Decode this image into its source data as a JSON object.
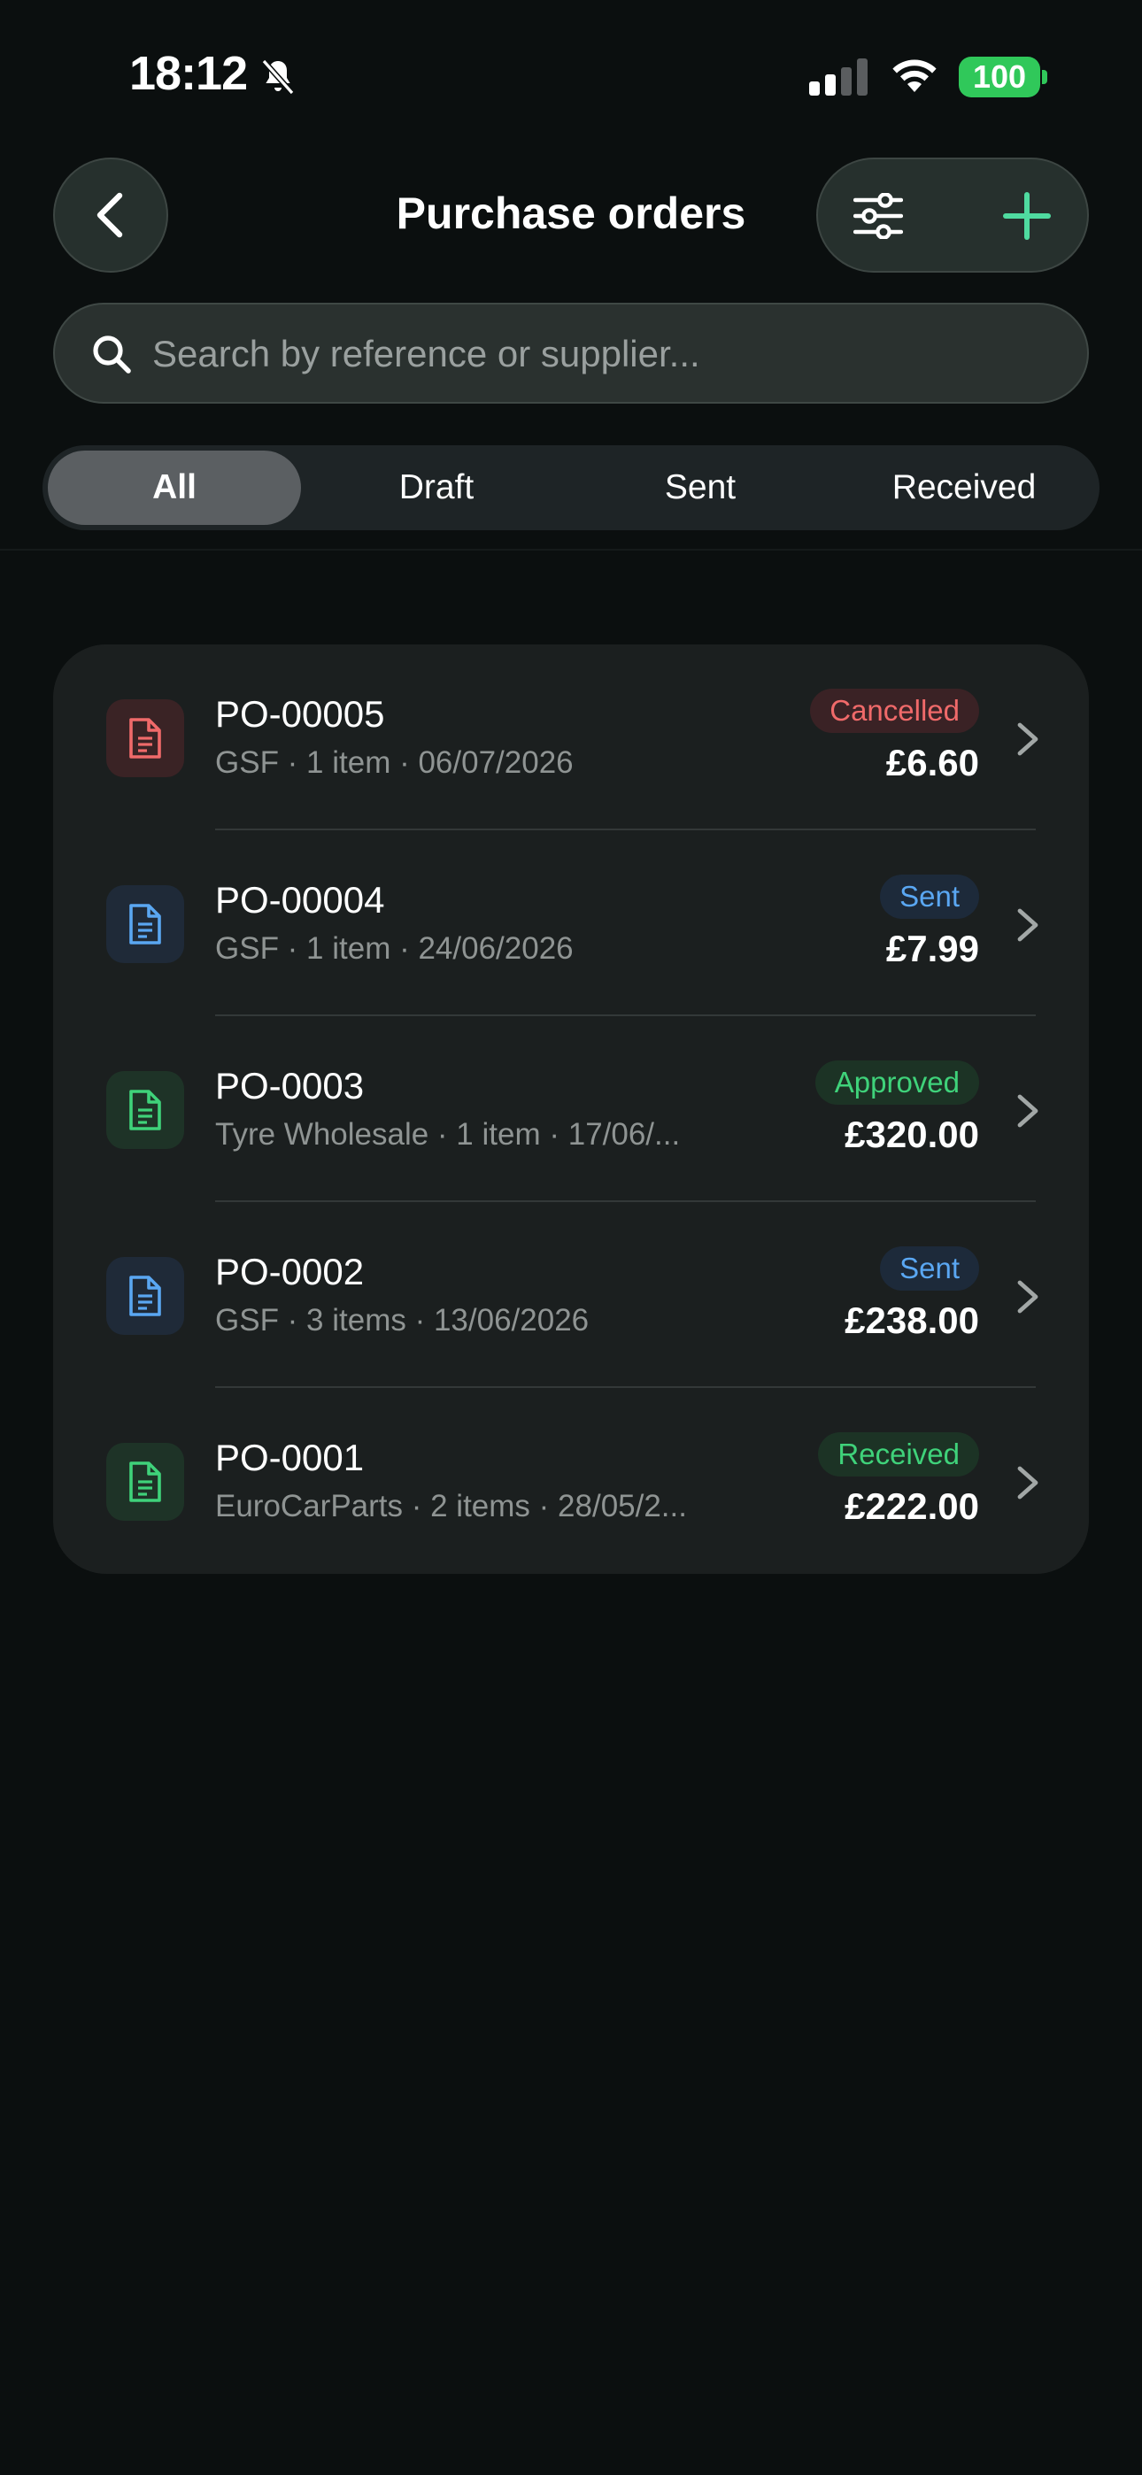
{
  "status_bar": {
    "time": "18:12",
    "battery": "100"
  },
  "header": {
    "title": "Purchase orders"
  },
  "search": {
    "placeholder": "Search by reference or supplier..."
  },
  "tabs": [
    {
      "label": "All",
      "active": true
    },
    {
      "label": "Draft",
      "active": false
    },
    {
      "label": "Sent",
      "active": false
    },
    {
      "label": "Received",
      "active": false
    }
  ],
  "orders": [
    {
      "ref": "PO-00005",
      "meta": "GSF · 1 item · 06/07/2026",
      "status": "Cancelled",
      "amount": "£6.60",
      "color": "#f06a6a"
    },
    {
      "ref": "PO-00004",
      "meta": "GSF · 1 item · 24/06/2026",
      "status": "Sent",
      "amount": "£7.99",
      "color": "#5aa7f2"
    },
    {
      "ref": "PO-0003",
      "meta": "Tyre Wholesale · 1 item · 17/06/...",
      "status": "Approved",
      "amount": "£320.00",
      "color": "#3fd27a"
    },
    {
      "ref": "PO-0002",
      "meta": "GSF · 3 items · 13/06/2026",
      "status": "Sent",
      "amount": "£238.00",
      "color": "#5aa7f2"
    },
    {
      "ref": "PO-0001",
      "meta": "EuroCarParts · 2 items · 28/05/2...",
      "status": "Received",
      "amount": "£222.00",
      "color": "#3fd27a"
    }
  ],
  "colors": {
    "accent": "#4fdba0",
    "background": "#0b0f0f",
    "card": "#1b1f1f"
  }
}
